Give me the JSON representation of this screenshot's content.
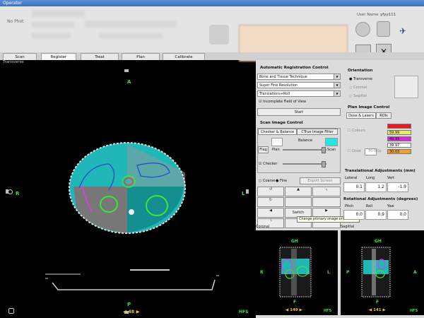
{
  "window": {
    "title": "Operator"
  },
  "header": {
    "no_photo": "No Phot",
    "user_label": "User Name",
    "user_name": "yfyy111"
  },
  "tabs": [
    "Scan",
    "Register",
    "Treat",
    "Plan",
    "Calibrate"
  ],
  "viewer": {
    "label": "Transverse",
    "top": "A",
    "bottom": "P",
    "left": "R",
    "right": "L",
    "slice": "48",
    "hfs": "HFS"
  },
  "auto_reg": {
    "title": "Automatic Registration Control",
    "technique": "Bone and Tissue Technique",
    "resolution": "Super Fine Resolution",
    "dof": "Translations+Roll",
    "incomplete_fov": "Incomplete Field of View",
    "start": "Start"
  },
  "scan_image": {
    "title": "Scan Image Control",
    "tab1": "Checker & Balance",
    "tab2": "CTrue Image Filter",
    "balance": "Balance",
    "plan": "Plan",
    "scan": "Scan",
    "flag": "Flag",
    "checker": "Checker",
    "coarse": "Coarse",
    "fine": "Fine",
    "export": "Export Screen",
    "switch": "Switch",
    "tooltip": "Change primary image orientation"
  },
  "orientation": {
    "title": "Orientation",
    "options": [
      "Transverse",
      "Coronal",
      "Sagittal"
    ]
  },
  "plan_image": {
    "title": "Plan Image Control",
    "tab1": "Dose & Lasers",
    "tab2": "ROIs",
    "colors": "Colours",
    "dose": "Dose",
    "dose_val": "70.0",
    "dose_unit": "Gy",
    "levels": [
      "59.99",
      "49.99",
      "39.97",
      "30.03"
    ]
  },
  "translational": {
    "title": "Translational Adjustments (mm)",
    "cols": [
      "Lateral",
      "Long",
      "Vert"
    ],
    "values": [
      "0.1",
      "1.2",
      "-1.9"
    ]
  },
  "rotational": {
    "title": "Rotational Adjustments (degrees)",
    "cols": [
      "Pitch",
      "Roll",
      "Yaw"
    ],
    "values": [
      "0.0",
      "0.9",
      "0.0"
    ]
  },
  "coronal": {
    "label": "Coronal",
    "top": "GH",
    "bottom": "F",
    "left": "R",
    "right": "L",
    "slice": "149",
    "hfs": "HFS"
  },
  "sagittal": {
    "label": "Sagittal",
    "top": "GH",
    "bottom": "F",
    "left": "P",
    "right": "A",
    "slice": "141",
    "hfs": "HFS"
  }
}
